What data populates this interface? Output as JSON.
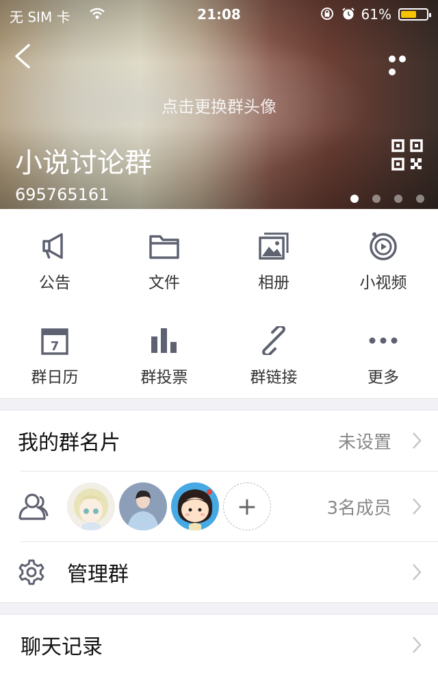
{
  "status_bar": {
    "carrier": "无 SIM 卡",
    "time": "21:08",
    "battery_percent": "61%",
    "battery_level": 0.61
  },
  "header": {
    "tap_hint": "点击更换群头像",
    "group_name": "小说讨论群",
    "group_id": "695765161",
    "page_count": 4,
    "active_page": 0
  },
  "features": [
    {
      "label": "公告",
      "icon": "megaphone-icon"
    },
    {
      "label": "文件",
      "icon": "folder-icon"
    },
    {
      "label": "相册",
      "icon": "album-icon"
    },
    {
      "label": "小视频",
      "icon": "video-icon"
    },
    {
      "label": "群日历",
      "icon": "calendar-icon"
    },
    {
      "label": "群投票",
      "icon": "vote-icon"
    },
    {
      "label": "群链接",
      "icon": "link-icon"
    },
    {
      "label": "更多",
      "icon": "more-icon"
    }
  ],
  "calendar_day": "7",
  "rows": {
    "card": {
      "title": "我的群名片",
      "value": "未设置"
    },
    "members": {
      "value": "3名成员",
      "add_symbol": "+"
    },
    "manage": {
      "title": "管理群"
    },
    "history": {
      "title": "聊天记录"
    }
  },
  "colors": {
    "icon": "#5d6170",
    "battery": "#f7c400"
  }
}
